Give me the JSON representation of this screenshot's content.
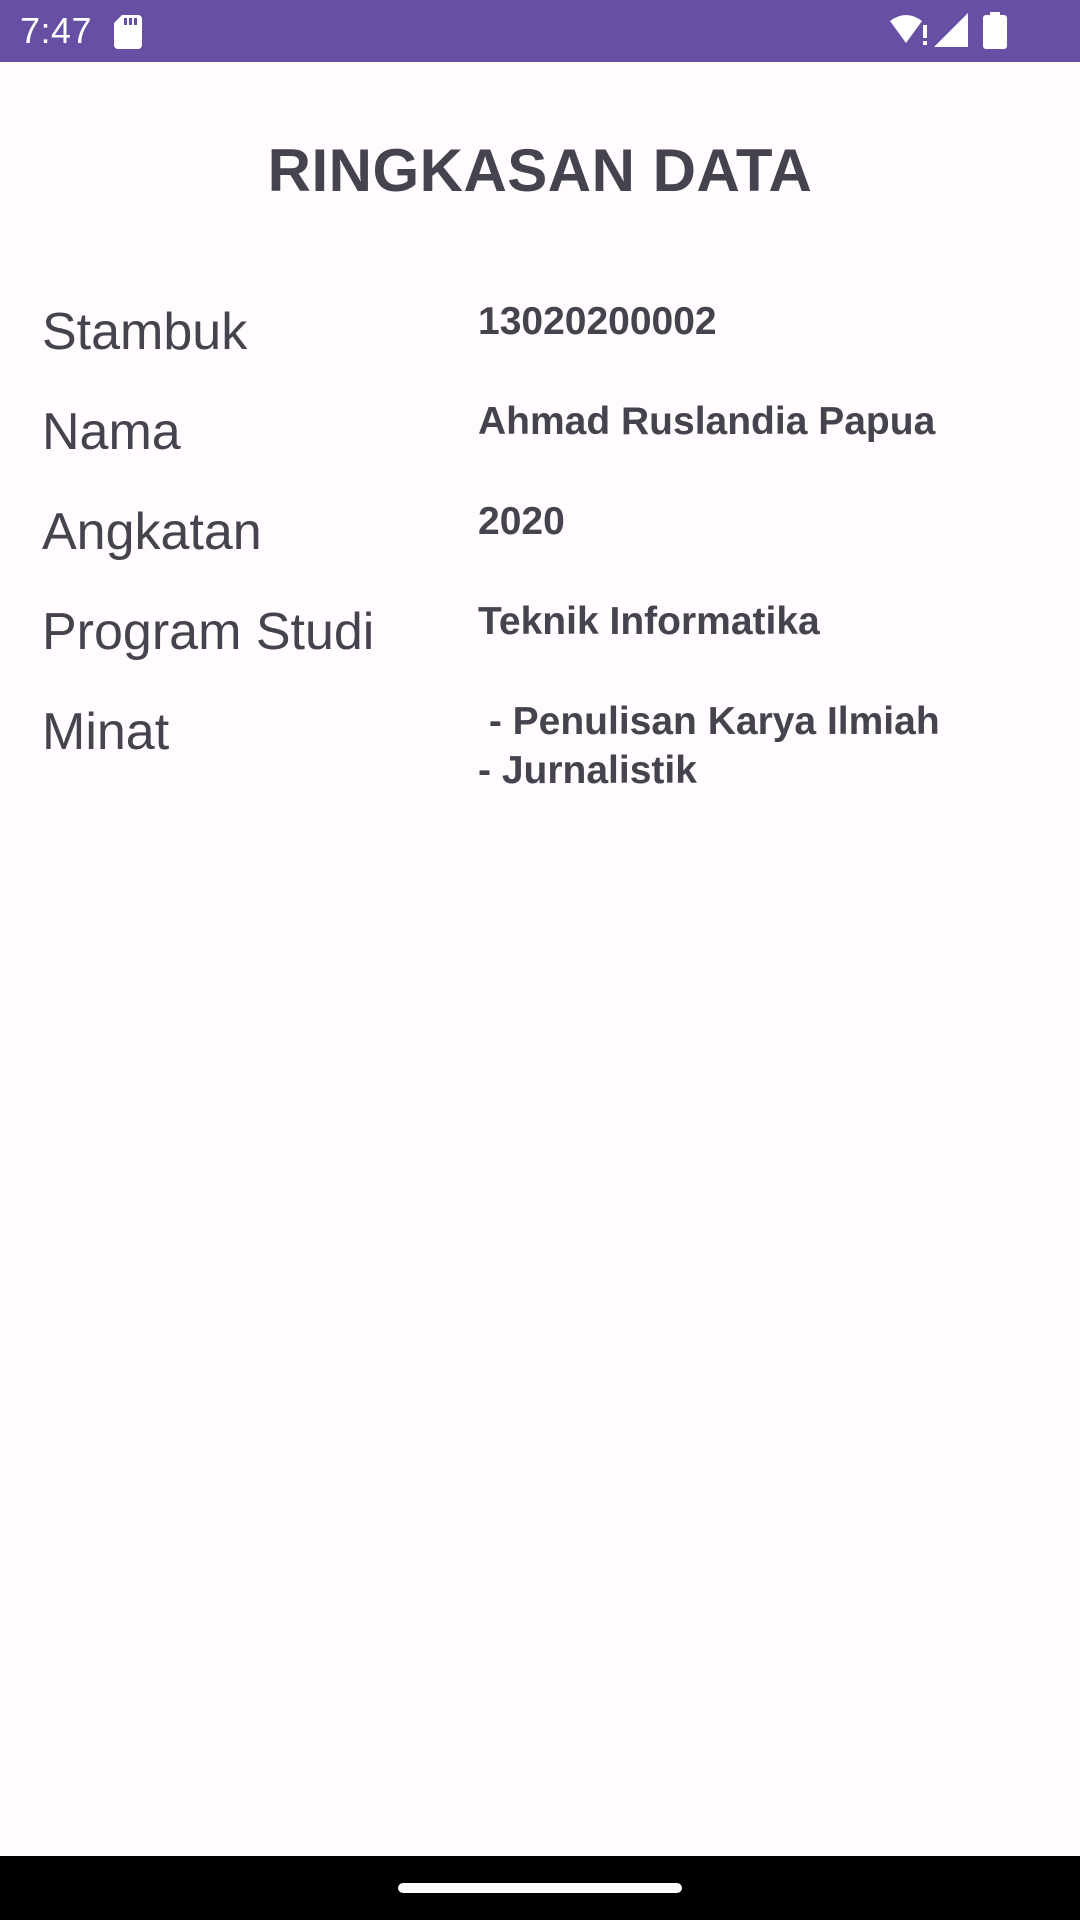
{
  "status_bar": {
    "time": "7:47",
    "icons": [
      "sd-card-icon",
      "wifi-icon",
      "signal-icon",
      "battery-icon"
    ],
    "background": "#6750a4"
  },
  "title": "RINGKASAN DATA",
  "rows": [
    {
      "label": "Stambuk",
      "value": "13020200002"
    },
    {
      "label": "Nama",
      "value": "Ahmad Ruslandia Papua"
    },
    {
      "label": "Angkatan",
      "value": "2020"
    },
    {
      "label": "Program Studi",
      "value": "Teknik Informatika"
    },
    {
      "label": "Minat",
      "value": " - Penulisan Karya Ilmiah\n- Jurnalistik"
    }
  ],
  "colors": {
    "text": "#45434d",
    "background": "#fffbfe"
  }
}
